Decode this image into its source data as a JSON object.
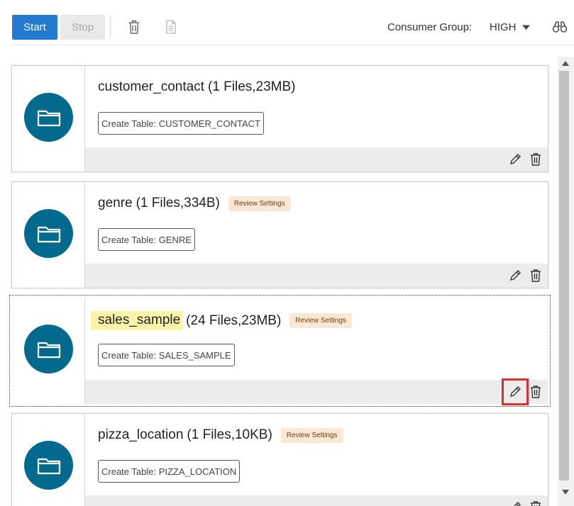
{
  "toolbar": {
    "start_label": "Start",
    "stop_label": "Stop",
    "consumer_group_label": "Consumer Group:",
    "consumer_group_value": "HIGH"
  },
  "cards": [
    {
      "name": "customer_contact",
      "info": "(1 Files,23MB)",
      "badge": "",
      "create_table": "Create Table: CUSTOMER_CONTACT"
    },
    {
      "name": "genre",
      "info": "(1 Files,334B)",
      "badge": "Review Settings",
      "create_table": "Create Table: GENRE"
    },
    {
      "name": "sales_sample",
      "info": "(24 Files,23MB)",
      "badge": "Review Settings",
      "create_table": "Create Table: SALES_SAMPLE"
    },
    {
      "name": "pizza_location",
      "info": "(1 Files,10KB)",
      "badge": "Review Settings",
      "create_table": "Create Table: PIZZA_LOCATION"
    }
  ],
  "icons": {
    "folder": "folder-icon",
    "edit": "pencil-icon",
    "delete": "trash-icon",
    "toolbar_delete": "trash-icon",
    "toolbar_doc": "document-icon",
    "search": "binoculars-icon",
    "caret": "caret-down-icon"
  },
  "colors": {
    "primary_button": "#227bcf",
    "folder_circle": "#036a8e",
    "badge_bg": "#fbe8d4",
    "highlight": "#fbf3a8",
    "marker_red": "#d9302c"
  }
}
